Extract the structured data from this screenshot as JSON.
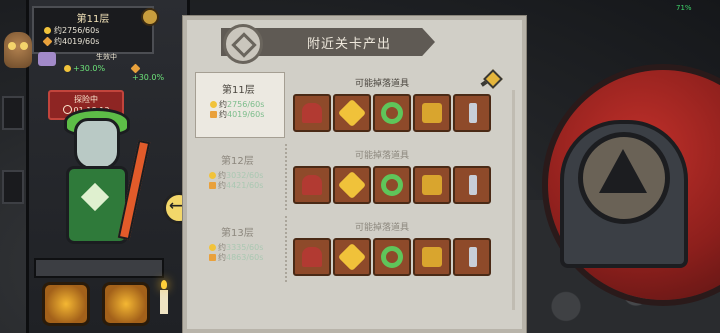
{
  "status_bar": {
    "battery_label": "71%"
  },
  "left_panel": {
    "floor_title": "第11层",
    "gold_rate": "约2756/60s",
    "xp_rate": "约4019/60s",
    "effect_label": "生效中",
    "gold_bonus": "+30.0%",
    "xp_bonus": "+30.0%",
    "explore_state": "探险中",
    "explore_timer": "01:18:13"
  },
  "dialog": {
    "title": "附近关卡产出",
    "rows": [
      {
        "floor": "第11层",
        "gold_label": "约",
        "gold_value": "2756/60s",
        "xp_label": "约",
        "xp_value": "4019/60s",
        "drops_label": "可能掉落道具",
        "items": [
          "helmet",
          "amulet",
          "ring",
          "box",
          "blade"
        ]
      },
      {
        "floor": "第12层",
        "gold_label": "约",
        "gold_value": "3032/60s",
        "xp_label": "约",
        "xp_value": "4421/60s",
        "drops_label": "可能掉落道具",
        "items": [
          "helmet",
          "amulet",
          "ring",
          "box",
          "blade"
        ]
      },
      {
        "floor": "第13层",
        "gold_label": "约",
        "gold_value": "3335/60s",
        "xp_label": "约",
        "xp_value": "4863/60s",
        "drops_label": "可能掉落道具",
        "items": [
          "helmet",
          "amulet",
          "ring",
          "box",
          "blade"
        ]
      }
    ]
  },
  "icons": {
    "gold": "gold-coin-icon",
    "xp": "xp-crystal-icon",
    "swap": "swap-arrows-icon"
  },
  "colors": {
    "accent_green": "#7dbd8c",
    "badge_red": "#8e2523",
    "parchment": "#d1cfc7"
  }
}
